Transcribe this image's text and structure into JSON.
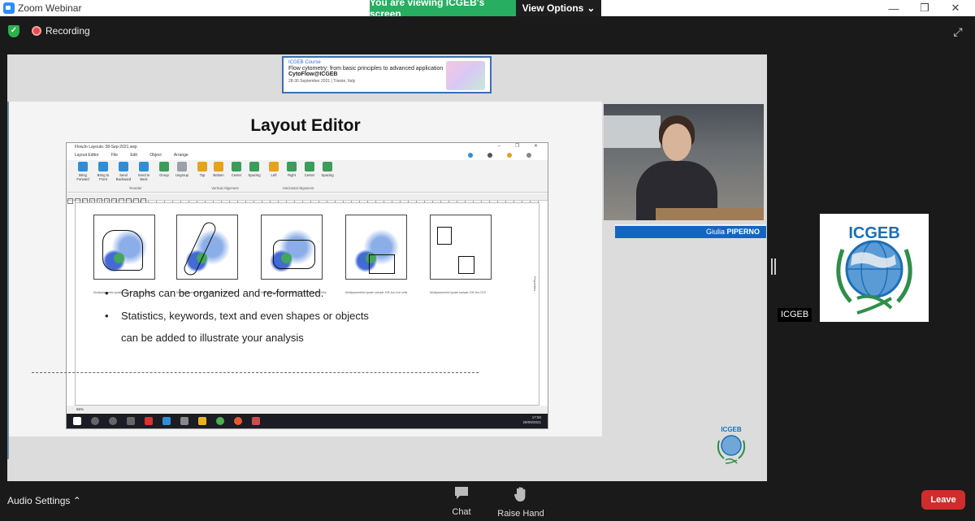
{
  "window": {
    "title": "Zoom Webinar",
    "minimize": "—",
    "restore": "❐",
    "close": "✕"
  },
  "share_banner": {
    "viewing_text": "You are viewing ICGEB's screen",
    "view_options": "View Options",
    "chevron": "⌄",
    "accent": "#27ae60"
  },
  "meeting_bar": {
    "recording_label": "Recording",
    "shield_glyph": "✓",
    "expand_glyph": "⤢",
    "recording_color": "#e84b4b"
  },
  "shared_content": {
    "course_banner": {
      "line1": "ICGEB Course",
      "line2": "Flow cytometry: from basic principles to advanced application",
      "line3": "CytoFlow@ICGEB",
      "line4": "28-30 September 2021 | Trieste, Italy"
    },
    "slide_title": "Layout Editor",
    "app_window": {
      "title": "FlowJo Layouts: 28-Sep-2021.wsp",
      "controls": "– ❐ ✕",
      "menu": [
        "Layout Editor",
        "File",
        "Edit",
        "Object",
        "Arrange"
      ],
      "ribbon_buttons": [
        {
          "label": "Bring Forward",
          "color": "#2e8fd8"
        },
        {
          "label": "Bring to Front",
          "color": "#2e8fd8"
        },
        {
          "label": "Send Backward",
          "color": "#2e8fd8"
        },
        {
          "label": "Send to Back",
          "color": "#2e8fd8"
        },
        {
          "label": "Group",
          "color": "#3a9d5a"
        },
        {
          "label": "Ungroup",
          "color": "#9aa0a6"
        },
        {
          "label": "Top",
          "color": "#e6a21f"
        },
        {
          "label": "Bottom",
          "color": "#e6a21f"
        },
        {
          "label": "Center",
          "color": "#3a9d5a"
        },
        {
          "label": "Spacing",
          "color": "#3a9d5a"
        },
        {
          "label": "Left",
          "color": "#e6a21f"
        },
        {
          "label": "Right",
          "color": "#3a9d5a"
        },
        {
          "label": "Center",
          "color": "#3a9d5a"
        },
        {
          "label": "Spacing",
          "color": "#3a9d5a"
        }
      ],
      "ribbon_groups": [
        "Reorder",
        "Vertical Alignment",
        "Horizontal Alignment"
      ],
      "plots": [
        {
          "caption": "Multiparametric lysate sample 10K.fcs Ungated"
        },
        {
          "caption": "Multiparametric lysate sample 10K.fcs All cells"
        },
        {
          "caption": "Multiparametric lysate sample 10K.fcs Single Cells"
        },
        {
          "caption": "Multiparametric lysate sample 10K.fcs Live cells"
        },
        {
          "caption": "Multiparametric lysate sample 10K.fcs CD3"
        }
      ],
      "properties_tab": "Properties",
      "zoom_level": "66%",
      "bullets": [
        "Graphs can be organized and re-formatted.",
        "Statistics, keywords, text and even shapes or objects"
      ],
      "bullet_continuation": "can be added to illustrate your analysis",
      "taskbar_time": "17:50",
      "taskbar_date": "29/09/2021"
    },
    "speaker_name": "Giulia",
    "speaker_surname": "PIPERNO",
    "logo_text": "ICGEB"
  },
  "participant": {
    "name": "ICGEB",
    "logo_text": "ICGEB"
  },
  "bottom_bar": {
    "audio_settings": "Audio Settings",
    "audio_chevron": "⌃",
    "chat": "Chat",
    "chat_icon": "chat-bubble-icon",
    "raise_hand": "Raise Hand",
    "raise_hand_icon": "hand-icon",
    "leave": "Leave",
    "leave_color": "#cf2c2c"
  }
}
